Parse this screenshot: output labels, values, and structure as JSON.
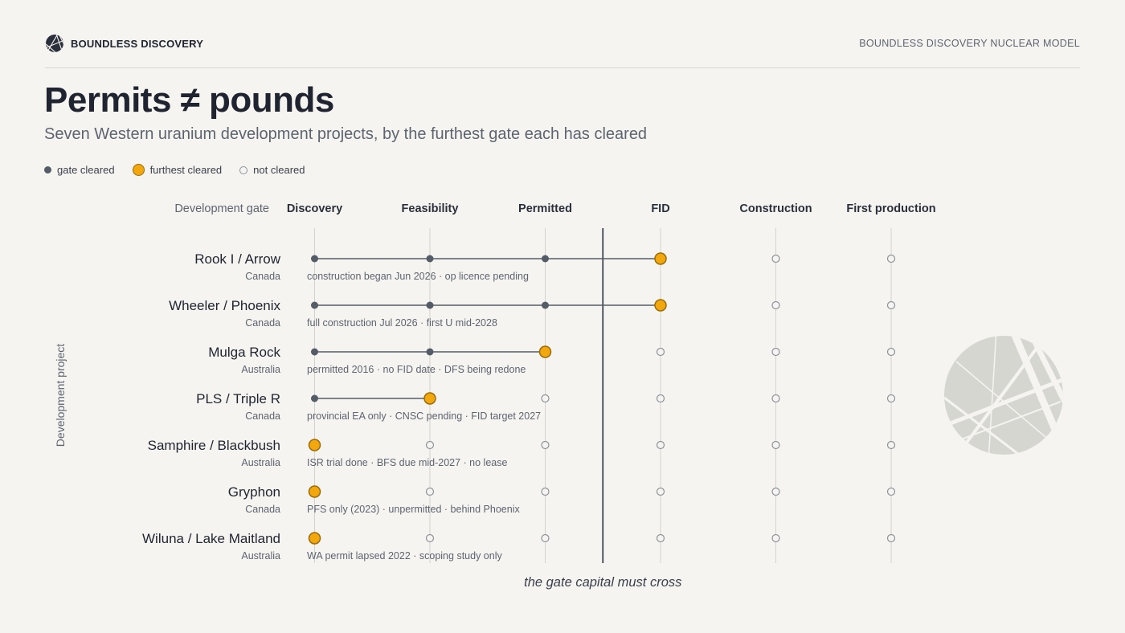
{
  "header": {
    "brand_name": "BOUNDLESS DISCOVERY",
    "model_name": "BOUNDLESS DISCOVERY NUCLEAR MODEL"
  },
  "title": "Permits ≠ pounds",
  "subtitle": "Seven Western uranium development projects, by the furthest gate each has cleared",
  "legend": {
    "cleared": "gate cleared",
    "furthest": "furthest cleared",
    "not_cleared": "not cleared"
  },
  "colors": {
    "cleared": "#545c68",
    "furthest": "#f2a70f",
    "furthest_stroke": "#9a6c0a",
    "not_cleared_stroke": "#8d939b",
    "gridline": "#d3d2cd",
    "threshold": "#3f4650",
    "watermark": "#d6d6d1"
  },
  "chart_data": {
    "type": "dot-timeline",
    "xlabel": "Development gate",
    "ylabel": "Development project",
    "gates": [
      "Discovery",
      "Feasibility",
      "Permitted",
      "FID",
      "Construction",
      "First production"
    ],
    "threshold_annotation": "the gate capital must cross",
    "threshold_between": [
      "Permitted",
      "FID"
    ],
    "projects": [
      {
        "name": "Rook I / Arrow",
        "country": "Canada",
        "furthest_gate": "FID",
        "note": "construction began Jun 2026 · op licence pending"
      },
      {
        "name": "Wheeler / Phoenix",
        "country": "Canada",
        "furthest_gate": "FID",
        "note": "full construction Jul 2026 · first U mid-2028"
      },
      {
        "name": "Mulga Rock",
        "country": "Australia",
        "furthest_gate": "Permitted",
        "note": "permitted 2016 · no FID date · DFS being redone"
      },
      {
        "name": "PLS / Triple R",
        "country": "Canada",
        "furthest_gate": "Feasibility",
        "note": "provincial EA only · CNSC pending · FID target 2027"
      },
      {
        "name": "Samphire / Blackbush",
        "country": "Australia",
        "furthest_gate": "Discovery",
        "note": "ISR trial done · BFS due mid-2027 · no lease"
      },
      {
        "name": "Gryphon",
        "country": "Canada",
        "furthest_gate": "Discovery",
        "note": "PFS only (2023) · unpermitted · behind Phoenix"
      },
      {
        "name": "Wiluna / Lake Maitland",
        "country": "Australia",
        "furthest_gate": "Discovery",
        "note": "WA permit lapsed 2022 · scoping study only"
      }
    ]
  }
}
